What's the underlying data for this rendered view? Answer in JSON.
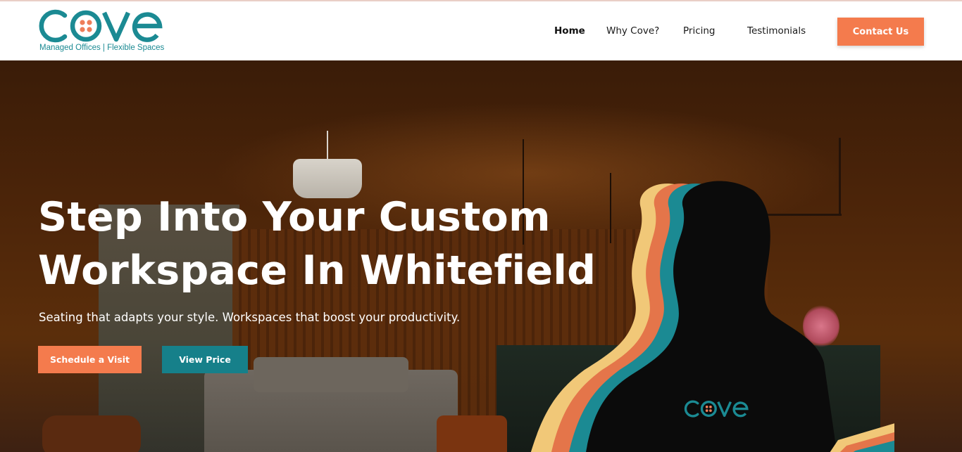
{
  "brand": {
    "logo_text": "cove",
    "tagline": "Managed Offices | Flexible Spaces",
    "colors": {
      "teal": "#1b8a93",
      "orange": "#f47b4d",
      "dots": "#ee7e5a"
    }
  },
  "nav": {
    "items": [
      {
        "label": "Home",
        "active": true
      },
      {
        "label": "Why Cove?",
        "active": false
      },
      {
        "label": "Pricing",
        "active": false
      },
      {
        "label": "Testimonials",
        "active": false
      }
    ],
    "cta": "Contact Us"
  },
  "hero": {
    "title_line1": "Step Into Your Custom",
    "title_line2": "Workspace In Whitefield",
    "subtitle": "Seating that adapts your style. Workspaces that boost your productivity.",
    "primary_button": "Schedule a Visit",
    "secondary_button": "View Price",
    "shirt_logo": "cove"
  }
}
